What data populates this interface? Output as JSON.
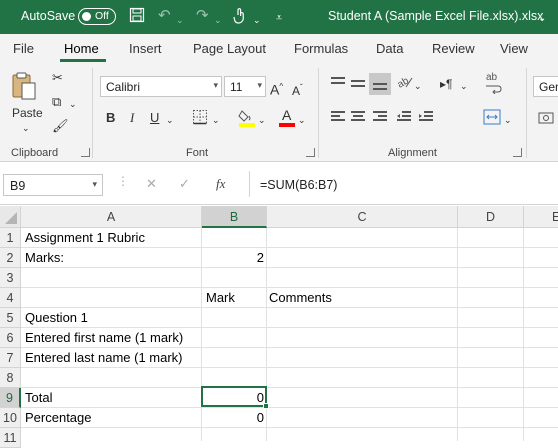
{
  "titlebar": {
    "autosave_label": "AutoSave",
    "autosave_state": "Off",
    "document_title": "Student A (Sample Excel File.xlsx).xlsx",
    "more_label": "⌄",
    "quick_access_icons": [
      "save-icon",
      "undo-icon",
      "redo-icon",
      "touch-mode-icon",
      "customize-icon"
    ]
  },
  "tabs": [
    "File",
    "Home",
    "Insert",
    "Page Layout",
    "Formulas",
    "Data",
    "Review",
    "View"
  ],
  "active_tab": "Home",
  "ribbon": {
    "clipboard": {
      "label": "Clipboard",
      "paste_label": "Paste"
    },
    "font": {
      "label": "Font",
      "font_name": "Calibri",
      "font_size": "11",
      "bold": "B",
      "italic": "I",
      "underline": "U",
      "grow": "A",
      "shrink": "A"
    },
    "alignment": {
      "label": "Alignment"
    },
    "number": {
      "format_partial": "Gen"
    }
  },
  "formula_bar": {
    "name_box": "B9",
    "fx_label": "fx",
    "formula": "=SUM(B6:B7)"
  },
  "grid": {
    "columns": [
      "A",
      "B",
      "C",
      "D",
      "E"
    ],
    "selected_column": "B",
    "rows": [
      "1",
      "2",
      "3",
      "4",
      "5",
      "6",
      "7",
      "8",
      "9",
      "10",
      "11"
    ],
    "selected_row": "9",
    "cells": {
      "A1": "Assignment 1 Rubric",
      "A2": "Marks:",
      "B2": "2",
      "B4": "Mark",
      "C4": "Comments",
      "A5": "Question 1",
      "A6": "Entered first name (1 mark)",
      "A7": "Entered last name (1 mark)",
      "A9": "Total",
      "B9": "0",
      "A10": "Percentage",
      "B10": "0"
    },
    "selected_cell": "B9"
  },
  "colors": {
    "accent": "#217346",
    "ribbon_bg": "#f3f3f3",
    "font_highlight": "#ffff00",
    "font_color": "#ff0000"
  }
}
